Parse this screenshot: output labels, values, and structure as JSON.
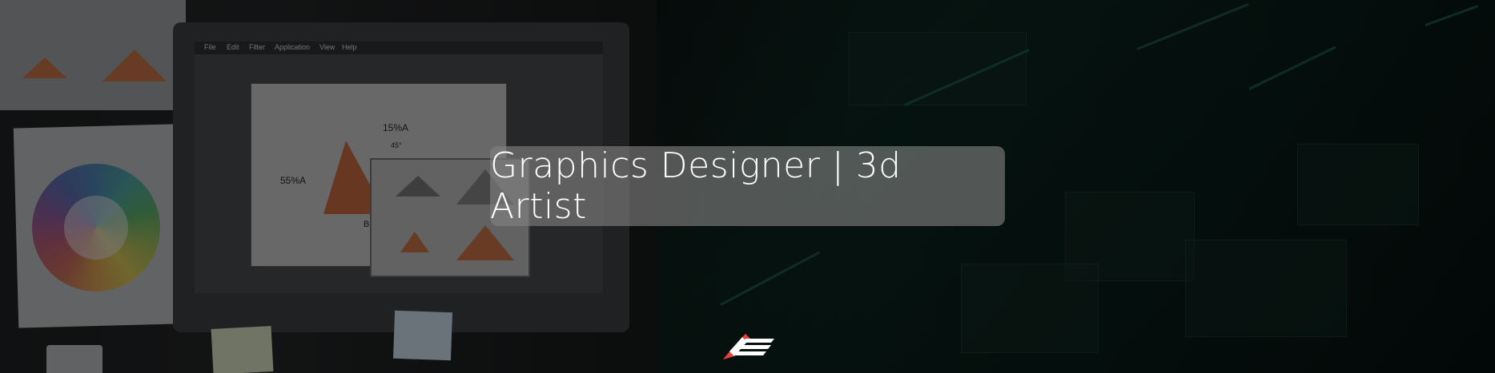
{
  "banner": {
    "title": "Graphics Designer | 3d Artist"
  },
  "scene": {
    "menu_items": [
      "File",
      "Edit",
      "Filter",
      "Application",
      "View",
      "Help"
    ],
    "labels": {
      "percent_top": "15%A",
      "percent_left": "55%A",
      "angle": "45°",
      "side": "B"
    }
  },
  "icons": {
    "logo": "pencil-lines-logo-icon"
  },
  "colors": {
    "accent_green": "#1f5a46",
    "pill_bg": "#8a8a8a",
    "title_text": "#ffffff",
    "logo_red": "#e8433a"
  }
}
